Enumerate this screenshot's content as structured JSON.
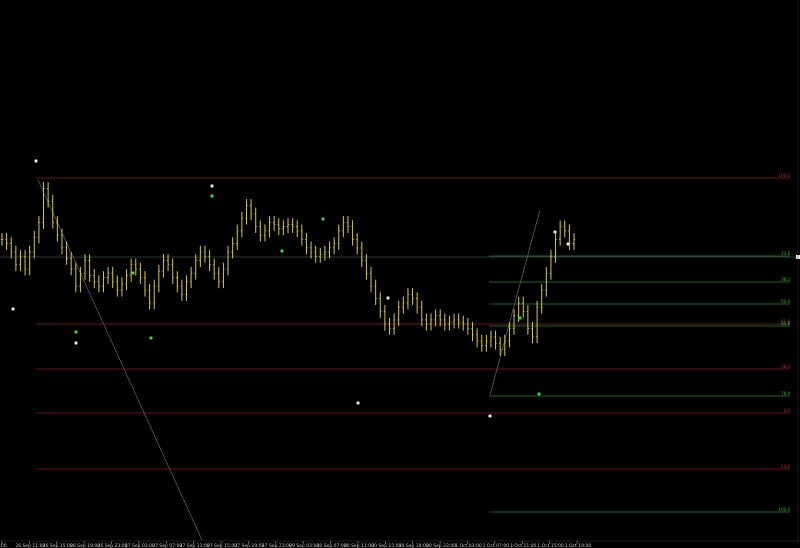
{
  "chart_data": {
    "type": "bar",
    "title": "",
    "xlabel": "",
    "ylabel": "",
    "colors": {
      "background": "#000000",
      "bars": "#d4c84a",
      "red_levels": "#8b1a1a",
      "green_levels": "#1f8a2a",
      "horizontal_line": "#2f4f4f",
      "trend_line": "#5a5a5a",
      "white_fractal": "#e6e6e6",
      "green_fractal": "#38d838",
      "axis_text": "#c8c8c8"
    },
    "time_axis": {
      "ticks": [
        ":00",
        "26 Sep 11:00",
        "26 Sep 15:00",
        "26 Sep 19:00",
        "26 Sep 23:00",
        "27 Sep 03:00",
        "27 Sep 07:00",
        "27 Sep 11:00",
        "27 Sep 15:00",
        "27 Sep 19:00",
        "27 Sep 23:00",
        "29 Sep 03:00",
        "30 Sep 07:00",
        "30 Sep 11:00",
        "30 Sep 15:00",
        "30 Sep 19:00",
        "30 Sep 23:00",
        "1 Oct 03:00",
        "1 Oct 07:00",
        "1 Oct 11:00",
        "1 Oct 15:00",
        "1 Oct 19:00"
      ]
    },
    "price_axis": {
      "ylim": [
        0,
        100
      ]
    },
    "closes": [
      72,
      70,
      66,
      60,
      64,
      58,
      66,
      73,
      80,
      96,
      90,
      80,
      74,
      68,
      63,
      58,
      50,
      56,
      62,
      55,
      52,
      50,
      54,
      56,
      52,
      48,
      51,
      55,
      60,
      58,
      54,
      48,
      42,
      50,
      57,
      62,
      60,
      54,
      50,
      46,
      52,
      56,
      62,
      66,
      64,
      60,
      56,
      52,
      58,
      66,
      70,
      76,
      82,
      88,
      84,
      78,
      74,
      76,
      80,
      79,
      77,
      78,
      79,
      78,
      76,
      72,
      68,
      66,
      64,
      65,
      66,
      68,
      70,
      76,
      80,
      78,
      72,
      68,
      62,
      56,
      50,
      44,
      38,
      32,
      30,
      34,
      40,
      42,
      46,
      44,
      40,
      34,
      32,
      34,
      36,
      34,
      32,
      33,
      34,
      33,
      32,
      30,
      27,
      24,
      22,
      24,
      26,
      23,
      20,
      24,
      30,
      36,
      42,
      38,
      30,
      26,
      40,
      48,
      56,
      64,
      72,
      78,
      76,
      70,
      72
    ],
    "fib_levels": {
      "red": [
        "100.0",
        "61.8",
        "38.2",
        "0.0",
        "-23.6"
      ],
      "green": [
        "0.0",
        "23.6",
        "38.2",
        "50.0",
        "61.8",
        "76.4",
        "100.0",
        "161.8"
      ]
    },
    "fractals": {
      "white": [
        "a",
        "b",
        "c",
        "d",
        "e",
        "f",
        "g",
        "h",
        "i"
      ],
      "green": [
        "a",
        "b",
        "c",
        "d",
        "e",
        "f",
        "g",
        "h"
      ]
    }
  }
}
